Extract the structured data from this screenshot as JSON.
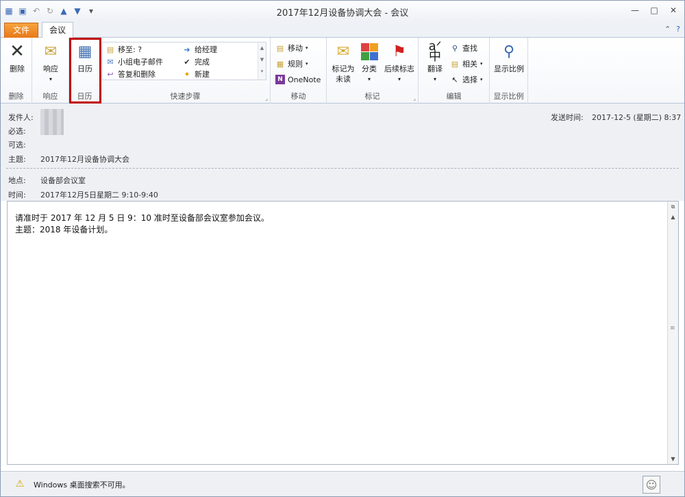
{
  "window": {
    "title": "2017年12月设备协调大会 - 会议"
  },
  "tabs": {
    "file": "文件",
    "meeting": "会议"
  },
  "ribbon": {
    "delete": {
      "label": "删除",
      "group": "删除"
    },
    "respond": {
      "label": "响应",
      "group": "响应"
    },
    "calendar": {
      "label": "日历",
      "group": "日历"
    },
    "quick_steps": {
      "group": "快速步骤",
      "items": [
        "移至: ?",
        "小组电子邮件",
        "答复和删除",
        "给经理",
        "完成",
        "新建"
      ]
    },
    "move": {
      "group": "移动",
      "items": [
        "移动",
        "规则",
        "OneNote"
      ]
    },
    "tags": {
      "group": "标记",
      "mark_unread": "标记为",
      "mark_unread2": "未读",
      "categorize": "分类",
      "follow_up": "后续标志"
    },
    "editing": {
      "group": "编辑",
      "translate": "翻译",
      "find": "查找",
      "related": "相关",
      "select": "选择"
    },
    "zoom": {
      "group": "显示比例",
      "label": "显示比例"
    }
  },
  "header": {
    "from_label": "发件人:",
    "required_label": "必选:",
    "optional_label": "可选:",
    "subject_label": "主题:",
    "subject": "2017年12月设备协调大会",
    "sent_label": "发送时间:",
    "sent_value": "2017-12-5 (星期二) 8:37",
    "location_label": "地点:",
    "location": "设备部会议室",
    "time_label": "时间:",
    "time": "2017年12月5日星期二 9:10-9:40"
  },
  "body": {
    "line1": "请准时于 2017 年 12 月 5 日  9：10 准时至设备部会议室参加会议。",
    "line2": "主题：2018 年设备计划。"
  },
  "status": {
    "text": "Windows 桌面搜索不可用。"
  }
}
